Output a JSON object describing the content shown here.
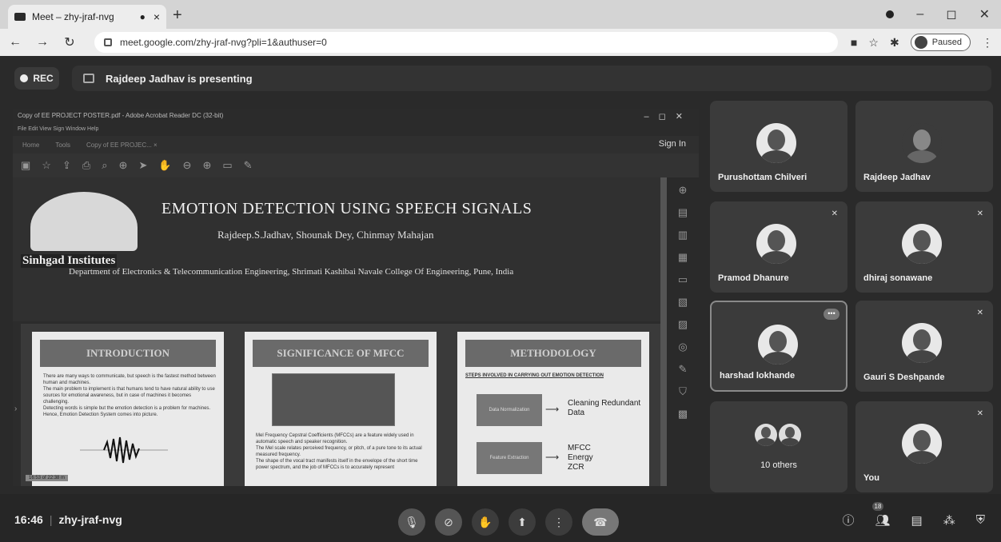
{
  "browser": {
    "tab_title": "Meet – zhy-jraf-nvg",
    "tab_rec_icon": "record-dot-icon",
    "new_tab_label": "+",
    "url": "meet.google.com/zhy-jraf-nvg?pli=1&authuser=0",
    "profile_status": "Paused"
  },
  "meet": {
    "rec_label": "REC",
    "presenting_text": "Rajdeep Jadhav is presenting",
    "meeting_code": "zhy-jraf-nvg",
    "time": "16:46",
    "participant_count": "18"
  },
  "acrobat": {
    "window_title": "Copy of EE PROJECT POSTER.pdf - Adobe Acrobat Reader DC (32-bit)",
    "menu": "File   Edit   View   Sign   Window   Help",
    "tab_home": "Home",
    "tab_tools": "Tools",
    "tab_doc": "Copy of EE PROJEC...   ×",
    "sign_in": "Sign In"
  },
  "poster": {
    "institute": "Sinhgad Institutes",
    "title": "EMOTION DETECTION USING SPEECH SIGNALS",
    "authors": "Rajdeep.S.Jadhav, Shounak Dey, Chinmay Mahajan",
    "department": "Department of Electronics & Telecommunication Engineering, Shrimati Kashibai Navale College Of Engineering, Pune, India",
    "sections": [
      {
        "heading": "INTRODUCTION"
      },
      {
        "heading": "SIGNIFICANCE OF MFCC"
      },
      {
        "heading": "METHODOLOGY"
      }
    ],
    "intro_bullets": [
      "There are many ways to communicate, but speech is the fastest method between human and machines.",
      "The main problem to implement is that humans tend to have natural ability to use sources for emotional awareness, but in case of machines it becomes challenging.",
      "Detecting words is simple but the emotion detection is a problem for machines.",
      "Hence, Emotion Detection System comes into picture."
    ],
    "mfcc_bullets": [
      "Mel Frequency Cepstral Coefficients (MFCCs) are a feature widely used in automatic speech and speaker recognition.",
      "The Mel scale relates perceived frequency, or pitch, of a pure tone to its actual measured frequency.",
      "The shape of the vocal tract manifests itself in the envelope of the short time power spectrum, and the job of MFCCs is to accurately represent"
    ],
    "method_subheading": "STEPS INVOLVED IN CARRYING OUT EMOTION DETECTION",
    "method_box1": "Data Normalization",
    "method_box2": "Feature Extraction",
    "method_out1": "Cleaning Redundant Data",
    "method_out2": [
      "MFCC",
      "Energy",
      "ZCR"
    ],
    "time_tag": "16:53 of 22:38 m"
  },
  "participants": [
    {
      "name": "Purushottam Chilveri",
      "muted": false
    },
    {
      "name": "Rajdeep Jadhav",
      "muted": false
    },
    {
      "name": "Pramod Dhanure",
      "muted": true
    },
    {
      "name": "dhiraj sonawane",
      "muted": true
    },
    {
      "name": "harshad lokhande",
      "muted": false
    },
    {
      "name": "Gauri S Deshpande",
      "muted": true
    },
    {
      "name": "10 others",
      "muted": false
    },
    {
      "name": "You",
      "muted": true
    }
  ],
  "colors": {
    "meet_bg": "#2a2a2a",
    "tile_bg": "#3b3b3b"
  }
}
